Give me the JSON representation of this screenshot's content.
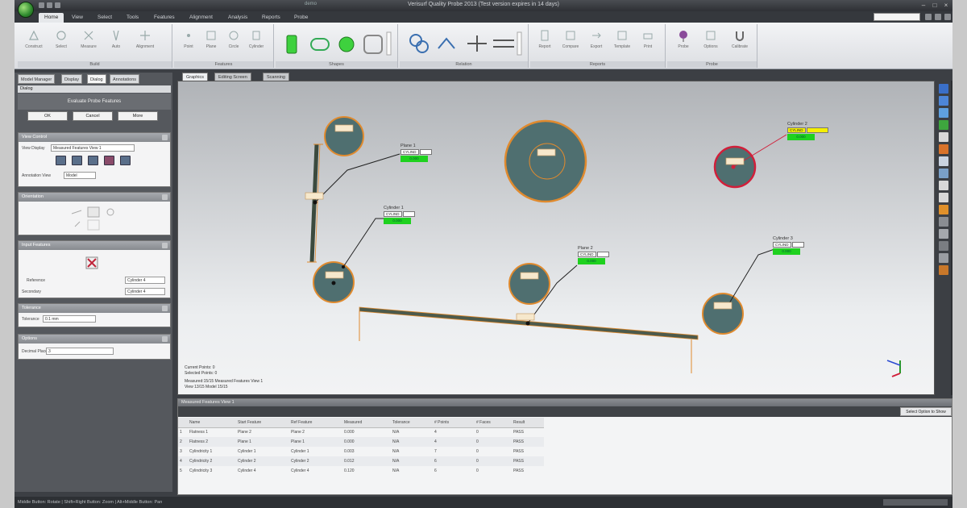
{
  "window": {
    "title": "Verisurf Quality Probe 2013 (Test version expires in 14 days)",
    "doc_tab": "demo"
  },
  "ribbon_tabs": [
    "Home",
    "View",
    "Select",
    "Tools",
    "Features",
    "Alignment",
    "Analysis",
    "Reports",
    "Probe"
  ],
  "ribbon_groups": [
    {
      "label": "Build",
      "buttons": [
        "Construct",
        "Select",
        "Measure",
        "Auto",
        "Alignment"
      ]
    },
    {
      "label": "Features",
      "buttons": [
        "Point",
        "Plane",
        "Circle",
        "Cylinder"
      ]
    },
    {
      "label": "Shapes",
      "buttons": []
    },
    {
      "label": "Relation",
      "buttons": []
    },
    {
      "label": "Reports",
      "buttons": [
        "Report",
        "Compare",
        "Export",
        "Template",
        "Print"
      ]
    },
    {
      "label": "Probe",
      "buttons": [
        "Probe",
        "Options",
        "Calibrate"
      ]
    }
  ],
  "left_panel": {
    "tabs": [
      "Model Manager",
      "Display",
      "Dialog",
      "Annotations"
    ],
    "header": "Dialog",
    "dialog_title": "Evaluate Probe Features",
    "buttons": {
      "ok": "OK",
      "cancel": "Cancel",
      "more": "More"
    },
    "sections": {
      "view_control": {
        "title": "View Control",
        "display_label": "View Display",
        "display_value": "Measured Features View 1",
        "annotation_label": "Annotation View",
        "annotation_value": "Model"
      },
      "orientation": {
        "title": "Orientation"
      },
      "input_features": {
        "title": "Input Features",
        "reference_label": "Reference",
        "reference_value": "Cylinder 4",
        "secondary_label": "Secondary",
        "secondary_value": "Cylinder 4"
      },
      "tolerance": {
        "title": "Tolerance",
        "label": "Tolerance",
        "value": "0.1 mm"
      },
      "options": {
        "title": "Options",
        "label": "Decimal Places",
        "value": "3"
      }
    }
  },
  "viewport": {
    "tabs": [
      "Graphics",
      "Editing Screen",
      "Scanning"
    ],
    "features": [
      {
        "label": "Plane 1",
        "box": "CYLIND",
        "value": "0.000"
      },
      {
        "label": "Cylinder 1",
        "box": "CYLIND",
        "value": "0.000"
      },
      {
        "label": "Plane 2",
        "box": "CYLIND",
        "value": "0.000"
      },
      {
        "label": "Cylinder 2",
        "box": "CYLIND",
        "value": "0.000"
      },
      {
        "label": "Cylinder 3",
        "box": "CYLIND",
        "value": "0.000"
      }
    ],
    "circle_tags": [
      "DIA",
      "DIA",
      "DIA",
      "DIA",
      "DIA",
      "DIA",
      "DIA"
    ],
    "stats": [
      "Current Points: 0",
      "Selected Points: 0",
      "Measured:15/15  Measured Features View 1",
      "View 13/15  Model 15/15"
    ]
  },
  "bottom_panel": {
    "title": "Measured Features View 1",
    "right_button": "Select Option to Show",
    "columns": [
      "",
      "Name",
      "Start Feature",
      "Ref Feature",
      "Measured",
      "Tolerance",
      "# Points",
      "# Faces",
      "Result"
    ],
    "rows": [
      [
        "1",
        "Flatness 1",
        "Plane 2",
        "Plane 2",
        "0.000",
        "N/A",
        "4",
        "0",
        "PASS"
      ],
      [
        "2",
        "Flatness 2",
        "Plane 1",
        "Plane 1",
        "0.000",
        "N/A",
        "4",
        "0",
        "PASS"
      ],
      [
        "3",
        "Cylindricity 1",
        "Cylinder 1",
        "Cylinder 1",
        "0.003",
        "N/A",
        "7",
        "0",
        "PASS"
      ],
      [
        "4",
        "Cylindricity 2",
        "Cylinder 2",
        "Cylinder 2",
        "0.012",
        "N/A",
        "6",
        "0",
        "PASS"
      ],
      [
        "5",
        "Cylindricity 3",
        "Cylinder 4",
        "Cylinder 4",
        "0.120",
        "N/A",
        "6",
        "0",
        "PASS"
      ]
    ]
  },
  "status": "Middle Button: Rotate | Shift+Right Button: Zoom | Alt+Middle Button: Pan",
  "colors": {
    "feature_green": "#1fd11f",
    "label_yellow": "#f5f000",
    "selected_red": "#d11f3a",
    "circle_fill": "#4f6f70",
    "circle_edge": "#e08a2e"
  }
}
